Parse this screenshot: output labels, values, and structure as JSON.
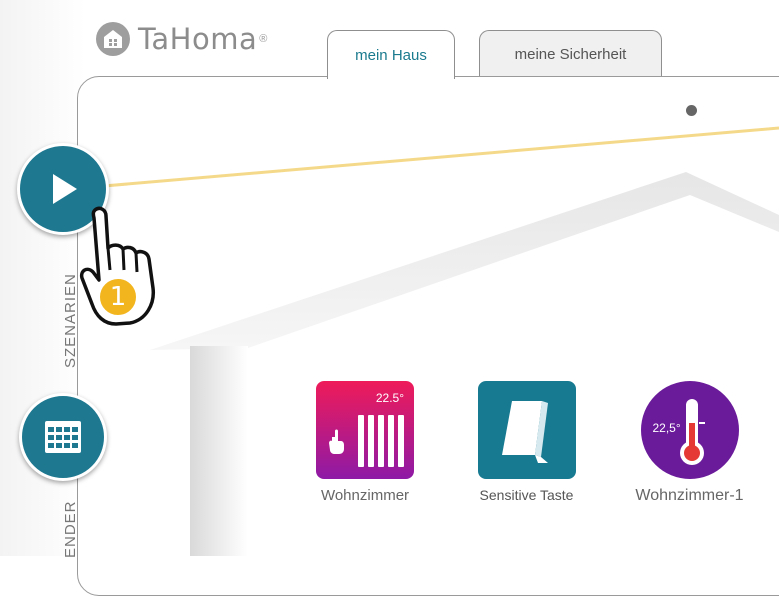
{
  "brand": {
    "name": "TaHoma",
    "registered": "®",
    "icon": "house-icon"
  },
  "tabs": [
    {
      "label": "mein Haus",
      "active": true
    },
    {
      "label": "meine Sicherheit",
      "active": false
    }
  ],
  "sidebar": {
    "scenarios": {
      "label": "SZENARIEN",
      "icon": "play-icon"
    },
    "calendar": {
      "label": "ENDER",
      "icon": "calendar-icon"
    }
  },
  "annotation": {
    "step": "1",
    "cursor": "hand-pointer-icon",
    "line_color": "#f5d98a"
  },
  "devices": [
    {
      "label": "Wohnzimmer",
      "reading": "22.5°",
      "icon": "radiator-icon"
    },
    {
      "label": "Sensitive Taste",
      "icon": "sensitive-switch-icon"
    },
    {
      "label": "Wohnzimmer-1",
      "reading": "22,5°",
      "icon": "thermometer-icon"
    }
  ],
  "colors": {
    "accent": "#1d7890",
    "radiator_gradient": [
      "#e8175d",
      "#8e1aa6"
    ],
    "switch_tile": "#177a90",
    "thermo_tile": "#6a1b9a",
    "badge": "#f2b51d"
  }
}
